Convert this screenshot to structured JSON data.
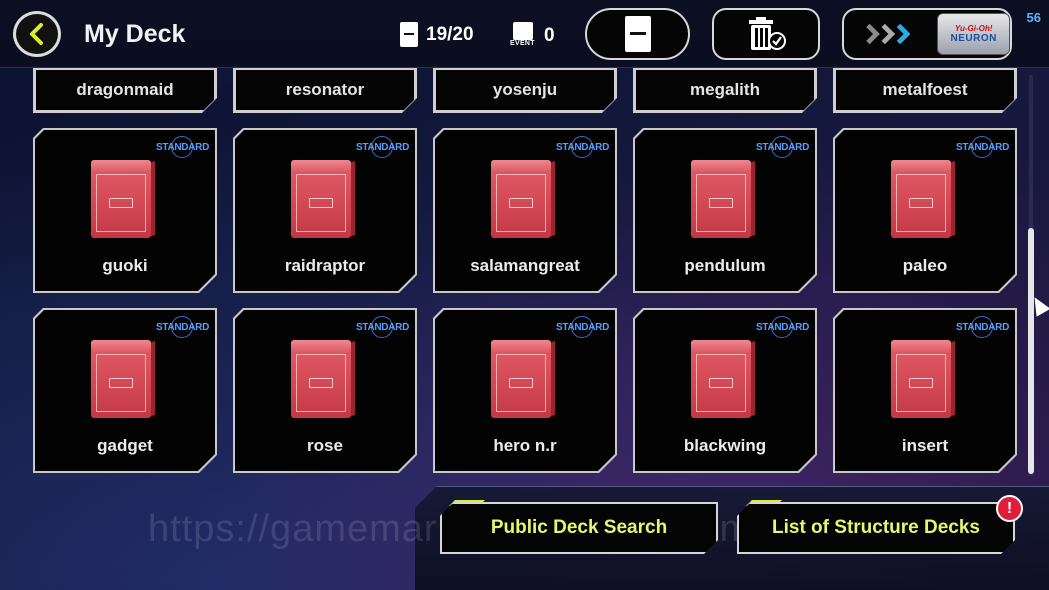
{
  "header": {
    "title": "My Deck",
    "deck_count": "19/20",
    "event_label": "EVENT",
    "event_count": "0",
    "fps": "56",
    "neuron_top": "Yu-Gi-Oh!",
    "neuron_label": "NEURON"
  },
  "tag_row": [
    "dragonmaid",
    "resonator",
    "yosenju",
    "megalith",
    "metalfoest"
  ],
  "badge_text": "STANDARD",
  "decks": [
    {
      "name": "guoki"
    },
    {
      "name": "raidraptor"
    },
    {
      "name": "salamangreat"
    },
    {
      "name": "pendulum"
    },
    {
      "name": "paleo"
    },
    {
      "name": "gadget"
    },
    {
      "name": "rose"
    },
    {
      "name": "hero n.r"
    },
    {
      "name": "blackwing"
    },
    {
      "name": "insert"
    }
  ],
  "bottom": {
    "public_search": "Public Deck Search",
    "structure_decks": "List of Structure Decks",
    "alert": "!"
  },
  "watermark": "https://gamemarket.gg/seller/GameMeno",
  "colors": {
    "deckbox": "#d84a56",
    "badge": "#5a9cff",
    "button_text": "#e9f56a",
    "alert": "#e01e3c"
  }
}
